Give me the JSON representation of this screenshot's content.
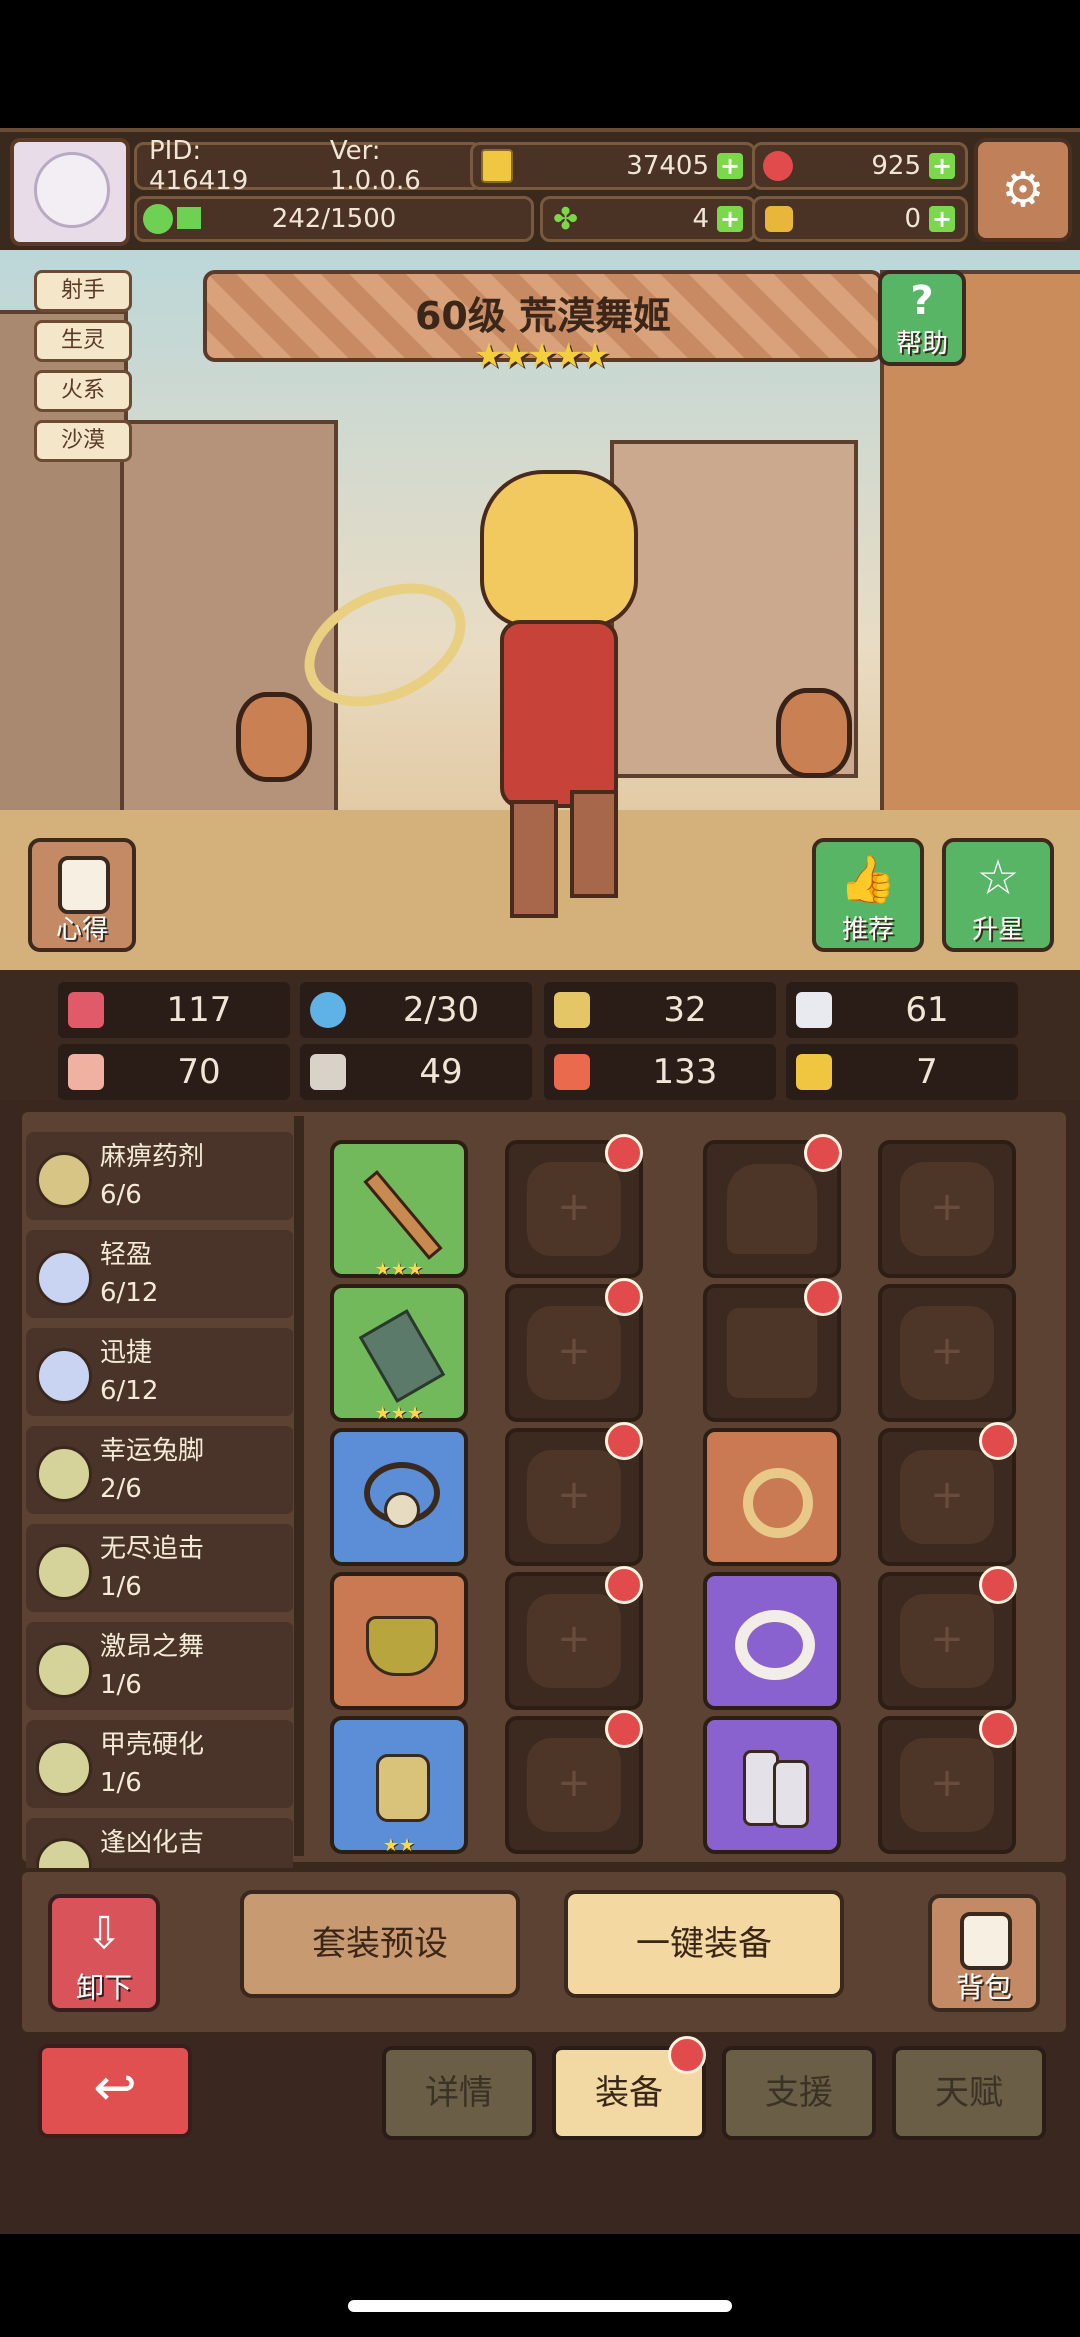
{
  "header": {
    "pid": "PID: 416419",
    "version": "Ver: 1.0.0.6",
    "gold": "37405",
    "gems": "925",
    "exp": "242/1500",
    "clover": "4",
    "horn": "0"
  },
  "tags": [
    "射手",
    "生灵",
    "火系",
    "沙漠"
  ],
  "hero": {
    "title": "60级  荒漠舞姬",
    "stars": "★★★★★",
    "help_label": "帮助",
    "insight_label": "心得",
    "recommend_label": "推荐",
    "upgrade_label": "升星"
  },
  "stats": [
    {
      "icon": "heart-icon",
      "value": "117",
      "color": "#e05a6a"
    },
    {
      "icon": "water-drop-icon",
      "value": "2/30",
      "color": "#5fb2e6"
    },
    {
      "icon": "shield-icon",
      "value": "32",
      "color": "#e5c667"
    },
    {
      "icon": "wing-icon",
      "value": "61",
      "color": "#e9e9f0"
    },
    {
      "icon": "fist-icon",
      "value": "70",
      "color": "#f0b1a3"
    },
    {
      "icon": "book-icon",
      "value": "49",
      "color": "#d9d2c8"
    },
    {
      "icon": "boot-icon",
      "value": "133",
      "color": "#e96a4c"
    },
    {
      "icon": "horseshoe-icon",
      "value": "7",
      "color": "#f0c640"
    }
  ],
  "skills": [
    {
      "name": "麻痹药剂",
      "count": "6/6"
    },
    {
      "name": "轻盈",
      "count": "6/12"
    },
    {
      "name": "迅捷",
      "count": "6/12"
    },
    {
      "name": "幸运兔脚",
      "count": "2/6"
    },
    {
      "name": "无尽追击",
      "count": "1/6"
    },
    {
      "name": "激昂之舞",
      "count": "1/6"
    },
    {
      "name": "甲壳硬化",
      "count": "1/6"
    },
    {
      "name": "逢凶化吉",
      "count": ""
    }
  ],
  "equipment": {
    "slot_stars_3": "★★★",
    "slot_stars_2": "★★"
  },
  "actions": {
    "unequip": "卸下",
    "preset": "套装预设",
    "auto_equip": "一键装备",
    "bag": "背包"
  },
  "tabs": [
    "详情",
    "装备",
    "支援",
    "天赋"
  ]
}
